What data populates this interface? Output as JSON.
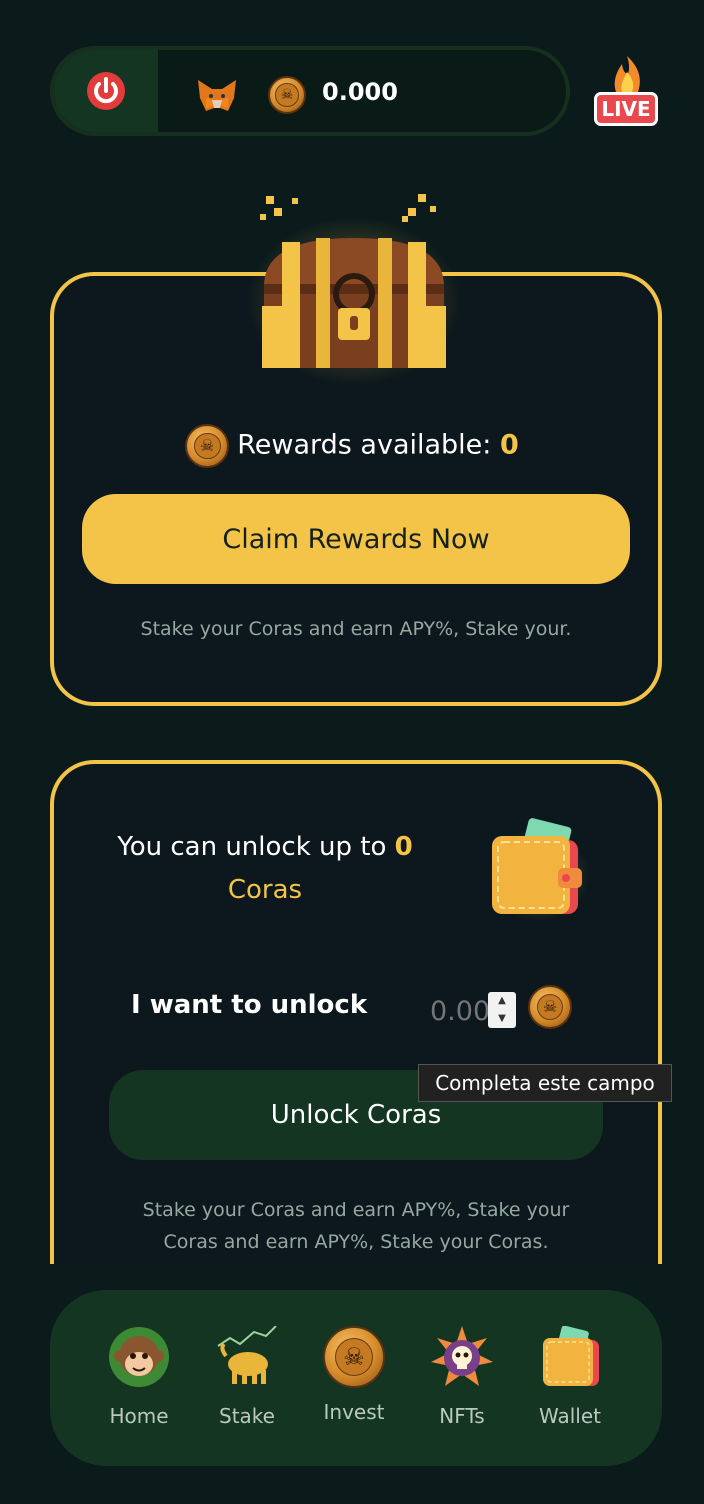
{
  "header": {
    "balance": "0.000",
    "live_label": "LIVE"
  },
  "rewards_card": {
    "rewards_label": "Rewards available:",
    "rewards_value": "0",
    "claim_button": "Claim Rewards Now",
    "note": "Stake your Coras and earn APY%, Stake your."
  },
  "unlock_card": {
    "title_prefix": "You can unlock up to",
    "amount": "0",
    "unit": "Coras",
    "want_label": "I want to unlock",
    "input_placeholder": "0.00",
    "tooltip": "Completa este campo",
    "unlock_button": "Unlock Coras",
    "note_line1": "Stake your Coras and earn APY%, Stake your",
    "note_line2": "Coras and earn APY%, Stake your Coras."
  },
  "nav": {
    "items": [
      {
        "label": "Home",
        "icon": "monkey-icon"
      },
      {
        "label": "Stake",
        "icon": "bull-chart-icon"
      },
      {
        "label": "Invest",
        "icon": "skull-coin-icon"
      },
      {
        "label": "NFTs",
        "icon": "skull-sun-icon"
      },
      {
        "label": "Wallet",
        "icon": "wallet-icon"
      }
    ]
  },
  "colors": {
    "background": "#0b1a1b",
    "accent": "#f3c447",
    "dark_green": "#143521"
  }
}
